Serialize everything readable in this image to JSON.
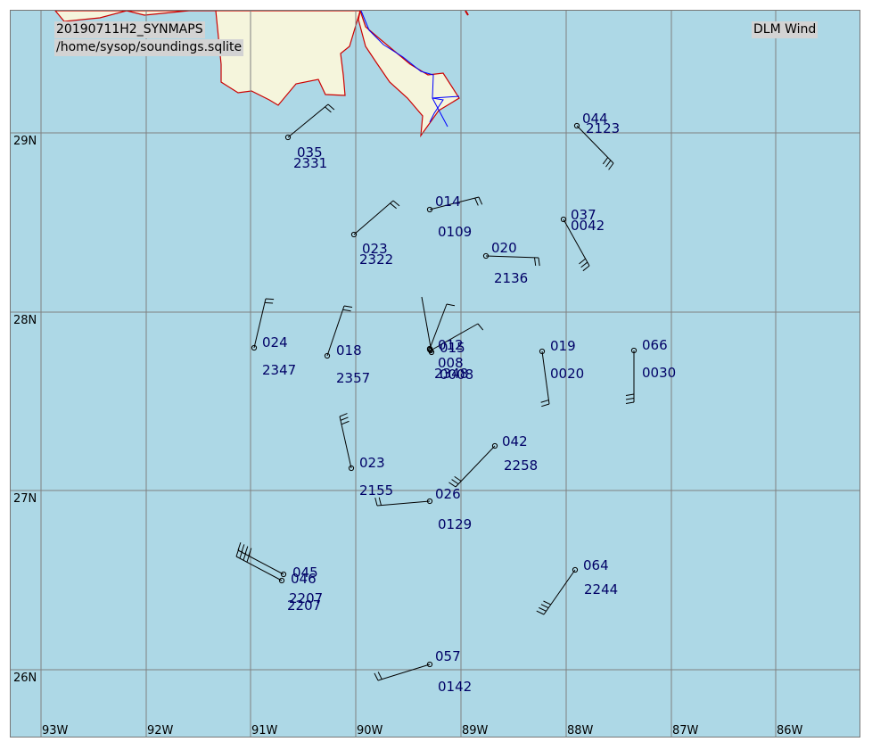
{
  "header": {
    "run_id": "20190711H2_SYNMAPS",
    "db_path": "/home/sysop/soundings.sqlite",
    "product": "DLM Wind"
  },
  "axes": {
    "lat_labels": [
      "29N",
      "28N",
      "27N",
      "26N"
    ],
    "lon_labels": [
      "93W",
      "92W",
      "91W",
      "90W",
      "89W",
      "88W",
      "87W",
      "86W"
    ]
  },
  "colors": {
    "water": "#add8e6",
    "land": "#f5f5dc",
    "coast": "#cc0000",
    "river": "#0000ff",
    "grid": "#808080",
    "label": "#000066"
  },
  "stations": [
    {
      "dir": "035",
      "time": "2331"
    },
    {
      "dir": "044",
      "time": "2123"
    },
    {
      "dir": "014",
      "time": "0109"
    },
    {
      "dir": "037",
      "time": "0042"
    },
    {
      "dir": "023",
      "time": "2322"
    },
    {
      "dir": "020",
      "time": "2136"
    },
    {
      "dir": "024",
      "time": "2347"
    },
    {
      "dir": "018",
      "time": "2357"
    },
    {
      "dir": "012",
      "time": ""
    },
    {
      "dir": "015",
      "time": ""
    },
    {
      "dir": "008",
      "time": "2348"
    },
    {
      "dir": "",
      "time": "0008"
    },
    {
      "dir": "019",
      "time": "0020"
    },
    {
      "dir": "066",
      "time": "0030"
    },
    {
      "dir": "042",
      "time": "2258"
    },
    {
      "dir": "023",
      "time": "2155"
    },
    {
      "dir": "026",
      "time": "0129"
    },
    {
      "dir": "045",
      "time": "2207"
    },
    {
      "dir": "046",
      "time": "2207"
    },
    {
      "dir": "064",
      "time": "2244"
    },
    {
      "dir": "057",
      "time": "0142"
    }
  ]
}
